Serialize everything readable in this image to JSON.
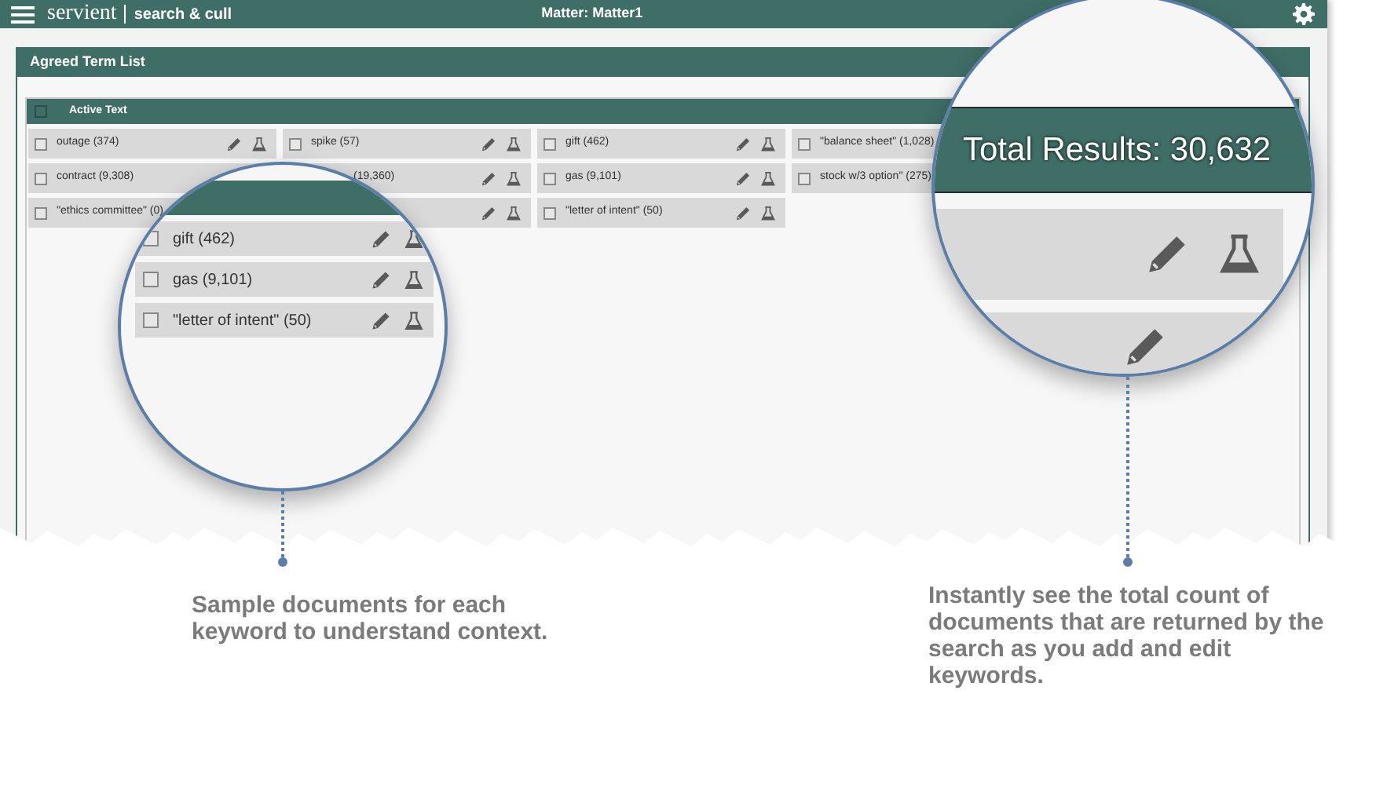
{
  "app_bar": {
    "logo": "servient",
    "module": "search & cull",
    "matter": "Matter: Matter1"
  },
  "panel": {
    "title": "Agreed Term List",
    "group": {
      "title": "Active Text",
      "checked": false,
      "terms": [
        {
          "kind": "full",
          "label": "outage (374)",
          "checked": false
        },
        {
          "kind": "full",
          "label": "spike (57)",
          "checked": false
        },
        {
          "kind": "full",
          "label": "gift (462)",
          "checked": false
        },
        {
          "kind": "label_only",
          "label": "\"balance sheet\" (1,028)",
          "checked": false
        },
        {
          "kind": "label_only",
          "label": "contract (9,308)",
          "checked": false
        },
        {
          "kind": "covered",
          "label": "(19,360)"
        },
        {
          "kind": "full",
          "label": "gas (9,101)",
          "checked": false
        },
        {
          "kind": "label_only",
          "label": "stock w/3 option\" (275)",
          "checked": false
        },
        {
          "kind": "label_only",
          "label": "\"ethics committee\" (0)",
          "checked": false
        },
        {
          "kind": "covered"
        },
        {
          "kind": "full",
          "label": "\"letter of intent\" (50)",
          "checked": false
        }
      ]
    }
  },
  "magnifiers": [
    {
      "kind": "terms",
      "terms": [
        {
          "label": "gift (462)",
          "checked": false
        },
        {
          "label": "gas (9,101)",
          "checked": false
        },
        {
          "label": "\"letter of intent\" (50)",
          "checked": false
        }
      ],
      "caption": "Sample documents for each keyword to understand context."
    },
    {
      "kind": "total",
      "total": "Total Results: 30,632",
      "caption": "Instantly see the total count of documents that are returned by the search as you add and edit keywords."
    }
  ]
}
